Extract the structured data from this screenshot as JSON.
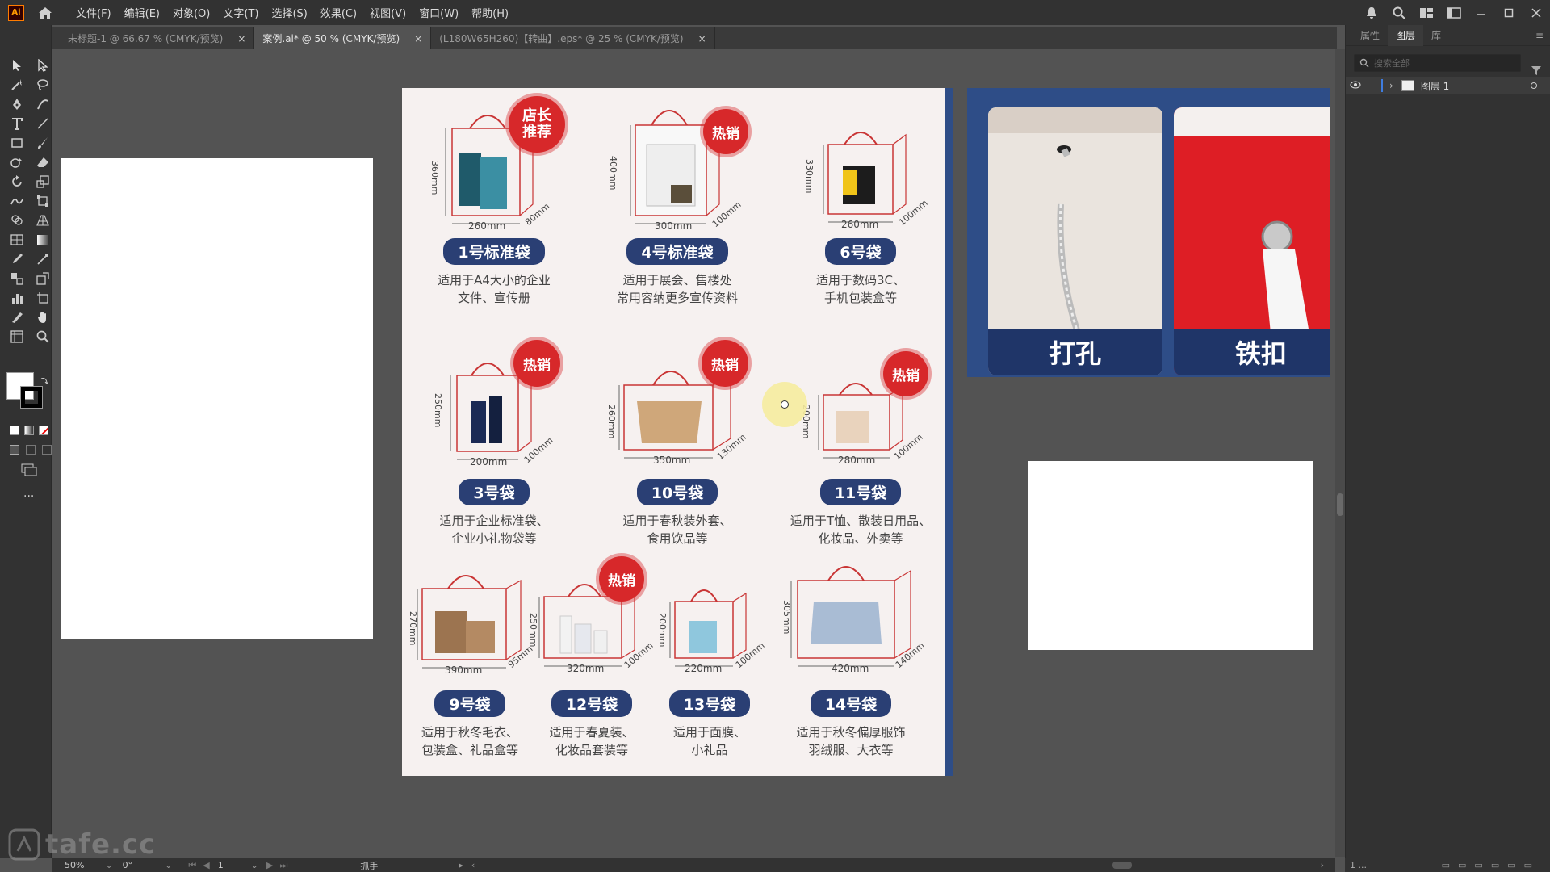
{
  "app": {
    "logo_text": "Ai",
    "menus": [
      "文件(F)",
      "编辑(E)",
      "对象(O)",
      "文字(T)",
      "选择(S)",
      "效果(C)",
      "视图(V)",
      "窗口(W)",
      "帮助(H)"
    ]
  },
  "tabs": [
    {
      "label": "未标题-1 @ 66.67 % (CMYK/预览)",
      "close": "×"
    },
    {
      "label": "案例.ai* @ 50 % (CMYK/预览)",
      "close": "×"
    },
    {
      "label": "(L180W65H260)【转曲】.eps* @ 25 % (CMYK/预览)",
      "close": "×"
    }
  ],
  "bags": [
    {
      "label": "1号标准袋",
      "desc": "适用于A4大小的企业\n文件、宣传册",
      "badge": "店长\n推荐",
      "dims": [
        "360mm",
        "260mm",
        "80mm"
      ]
    },
    {
      "label": "4号标准袋",
      "desc": "适用于展会、售楼处\n常用容纳更多宣传资料",
      "badge": "热销",
      "dims": [
        "400mm",
        "300mm",
        "100mm"
      ]
    },
    {
      "label": "6号袋",
      "desc": "适用于数码3C、\n手机包装盒等",
      "badge": "",
      "dims": [
        "330mm",
        "260mm",
        "100mm"
      ]
    },
    {
      "label": "3号袋",
      "desc": "适用于企业标准袋、\n企业小礼物袋等",
      "badge": "热销",
      "dims": [
        "250mm",
        "200mm",
        "100mm"
      ]
    },
    {
      "label": "10号袋",
      "desc": "适用于春秋装外套、\n食用饮品等",
      "badge": "热销",
      "dims": [
        "260mm",
        "350mm",
        "130mm"
      ]
    },
    {
      "label": "11号袋",
      "desc": "适用于T恤、散装日用品、\n化妆品、外卖等",
      "badge": "热销",
      "dims": [
        "200mm",
        "280mm",
        "100mm"
      ]
    },
    {
      "label": "9号袋",
      "desc": "适用于秋冬毛衣、\n包装盒、礼品盒等",
      "badge": "",
      "dims": [
        "270mm",
        "390mm",
        "95mm"
      ]
    },
    {
      "label": "12号袋",
      "desc": "适用于春夏装、\n化妆品套装等",
      "badge": "热销",
      "dims": [
        "250mm",
        "320mm",
        "100mm"
      ]
    },
    {
      "label": "13号袋",
      "desc": "适用于面膜、\n小礼品",
      "badge": "",
      "dims": [
        "200mm",
        "220mm",
        "100mm"
      ]
    },
    {
      "label": "14号袋",
      "desc": "适用于秋冬偏厚服饰\n羽绒服、大衣等",
      "badge": "",
      "dims": [
        "305mm",
        "420mm",
        "140mm"
      ]
    }
  ],
  "details": [
    {
      "caption": "打孔"
    },
    {
      "caption": "铁扣"
    }
  ],
  "right_panel": {
    "tabs": [
      "属性",
      "图层",
      "库"
    ],
    "search_placeholder": "搜索全部",
    "layer_name": "图层 1",
    "footer": "1 ..."
  },
  "status": {
    "zoom": "50%",
    "rotation": "0°",
    "artboard": "1",
    "tool": "抓手"
  },
  "watermark": "tafe.cc"
}
